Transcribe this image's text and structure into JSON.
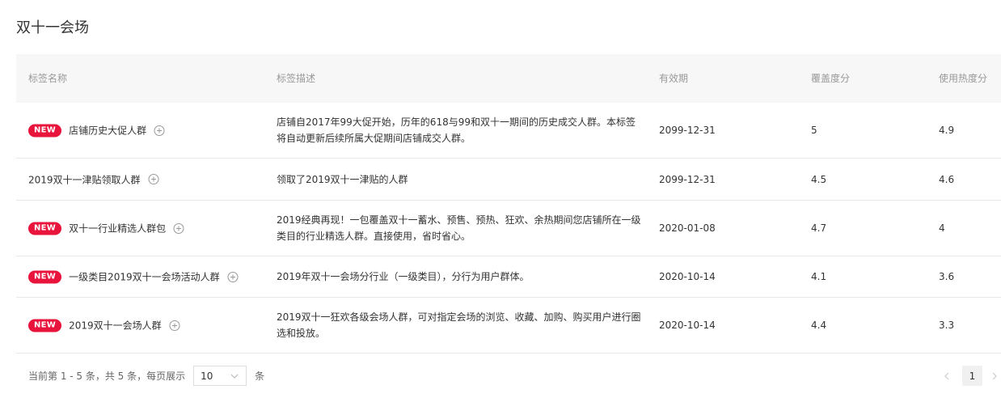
{
  "page": {
    "title": "双十一会场"
  },
  "table": {
    "headers": [
      "标签名称",
      "标签描述",
      "有效期",
      "覆盖度分",
      "使用热度分"
    ],
    "new_badge": "NEW",
    "rows": [
      {
        "is_new": true,
        "name": "店铺历史大促人群",
        "description": "店铺自2017年99大促开始，历年的618与99和双十一期间的历史成交人群。本标签将自动更新后续所属大促期间店铺成交人群。",
        "expiry": "2099-12-31",
        "coverage": "5",
        "usage": "4.9"
      },
      {
        "is_new": false,
        "name": "2019双十一津贴领取人群",
        "description": "领取了2019双十一津贴的人群",
        "expiry": "2099-12-31",
        "coverage": "4.5",
        "usage": "4.6"
      },
      {
        "is_new": true,
        "name": "双十一行业精选人群包",
        "description": "2019经典再现！一包覆盖双十一蓄水、预售、预热、狂欢、余热期间您店铺所在一级类目的行业精选人群。直接使用，省时省心。",
        "expiry": "2020-01-08",
        "coverage": "4.7",
        "usage": "4"
      },
      {
        "is_new": true,
        "name": "一级类目2019双十一会场活动人群",
        "description": "2019年双十一会场分行业（一级类目），分行为用户群体。",
        "expiry": "2020-10-14",
        "coverage": "4.1",
        "usage": "3.6"
      },
      {
        "is_new": true,
        "name": "2019双十一会场人群",
        "description": "2019双十一狂欢各级会场人群，可对指定会场的浏览、收藏、加购、购买用户进行圈选和投放。",
        "expiry": "2020-10-14",
        "coverage": "4.4",
        "usage": "3.3"
      }
    ]
  },
  "pagination": {
    "summary": "当前第 1 - 5 条，共 5 条，每页展示",
    "page_size": "10",
    "unit": "条",
    "current_page": "1"
  },
  "colors": {
    "accent": "#e8143b",
    "header_bg": "#f7f7f7",
    "border": "#e8e8e8"
  },
  "icons": {
    "add": "plus-circle-icon",
    "select": "chevron-down-icon",
    "prev": "chevron-left-icon",
    "next": "chevron-right-icon"
  }
}
